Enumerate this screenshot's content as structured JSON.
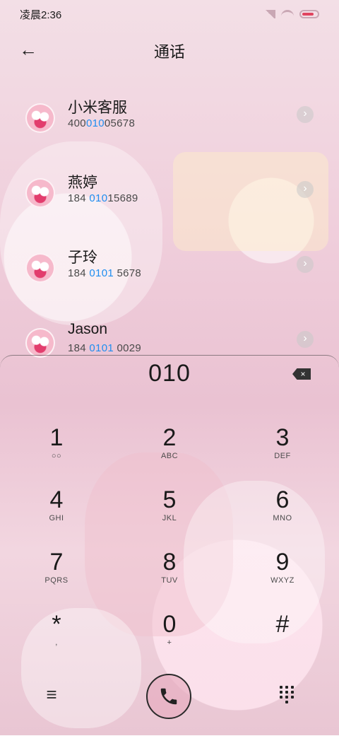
{
  "status": {
    "time": "凌晨2:36"
  },
  "header": {
    "title": "通话",
    "back_icon": "arrow-left-icon"
  },
  "contacts": [
    {
      "name": "小米客服",
      "number_pre": "400",
      "number_hl": "010",
      "number_post": "05678"
    },
    {
      "name": "燕婷",
      "number_pre": "184 ",
      "number_hl": "010",
      "number_post": "15689"
    },
    {
      "name": "子玲",
      "number_pre": "184 ",
      "number_hl": "0101",
      "number_post": " 5678"
    },
    {
      "name": "Jason",
      "number_pre": "184 ",
      "number_hl": "0101",
      "number_post": " 0029"
    }
  ],
  "dialpad": {
    "input": "010",
    "keys": [
      {
        "digit": "1",
        "letters": ""
      },
      {
        "digit": "2",
        "letters": "ABC"
      },
      {
        "digit": "3",
        "letters": "DEF"
      },
      {
        "digit": "4",
        "letters": "GHI"
      },
      {
        "digit": "5",
        "letters": "JKL"
      },
      {
        "digit": "6",
        "letters": "MNO"
      },
      {
        "digit": "7",
        "letters": "PQRS"
      },
      {
        "digit": "8",
        "letters": "TUV"
      },
      {
        "digit": "9",
        "letters": "WXYZ"
      },
      {
        "digit": "*",
        "letters": ","
      },
      {
        "digit": "0",
        "letters": "+"
      },
      {
        "digit": "#",
        "letters": ""
      }
    ]
  },
  "bottom": {
    "menu_icon": "menu-icon",
    "call_icon": "phone-icon",
    "dialpad_icon": "dialpad-grid-icon"
  },
  "colors": {
    "highlight": "#1f8ef0",
    "background": "#f0cfdc"
  }
}
